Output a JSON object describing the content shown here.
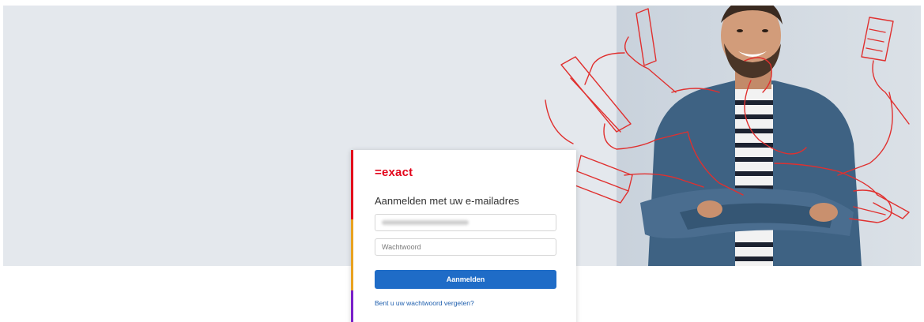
{
  "brand": {
    "logo_text": "=exact",
    "color_red": "#e3051b",
    "color_yellow": "#e9a220",
    "color_purple": "#7a1fc9"
  },
  "login": {
    "title": "Aanmelden met uw e-mailadres",
    "email_value_obscured": true,
    "password_placeholder": "Wachtwoord",
    "submit_label": "Aanmelden",
    "forgot_link": "Bent u uw wachtwoord vergeten?",
    "button_color": "#1f6cc7"
  },
  "hero": {
    "image": "smiling-man-with-many-arms-illustration"
  }
}
